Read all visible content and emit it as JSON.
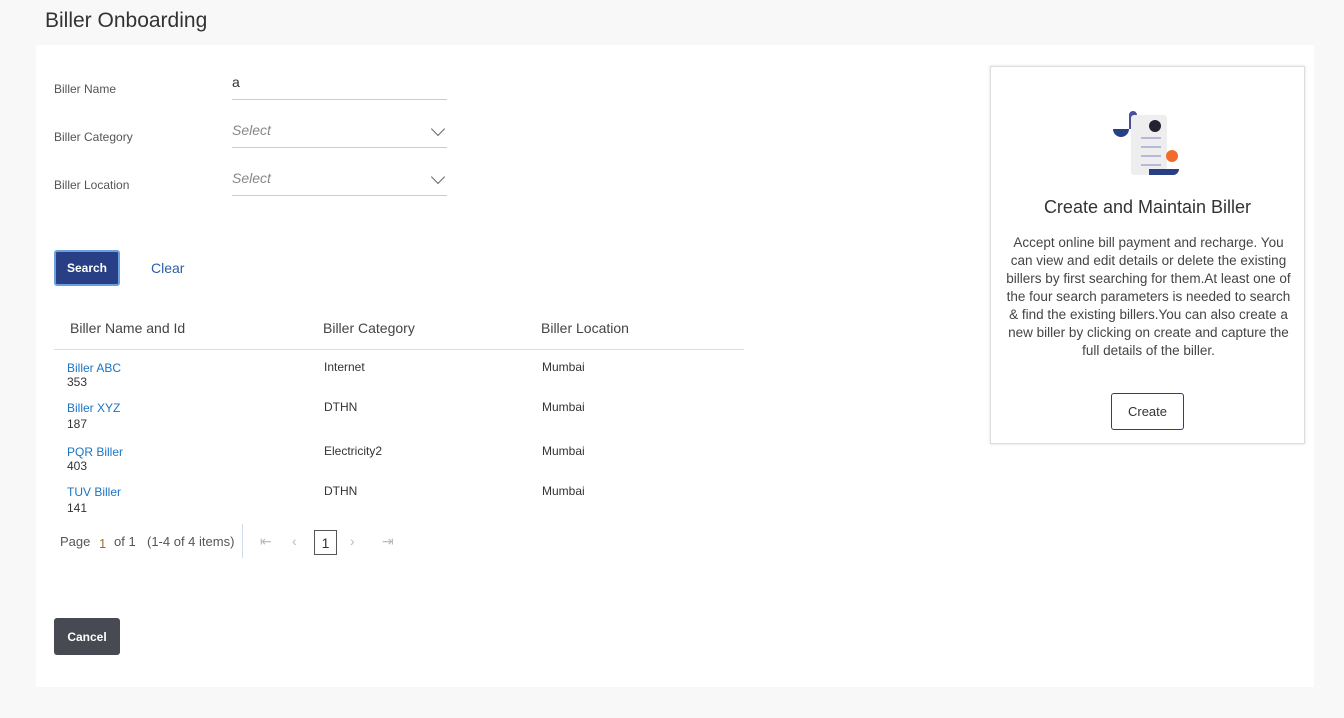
{
  "page_title": "Biller Onboarding",
  "form": {
    "biller_name_label": "Biller Name",
    "biller_name_value": "a",
    "category_label": "Biller Category",
    "category_value": "Select",
    "location_label": "Biller Location",
    "location_value": "Select"
  },
  "buttons": {
    "search": "Search",
    "clear": "Clear",
    "cancel": "Cancel",
    "create": "Create"
  },
  "table": {
    "headers": [
      "Biller Name and Id",
      "Biller Category",
      "Biller Location"
    ],
    "rows": [
      {
        "name": "Biller ABC",
        "id": "353",
        "category": "Internet",
        "location": "Mumbai"
      },
      {
        "name": "Biller XYZ",
        "id": "187",
        "category": "DTHN",
        "location": "Mumbai"
      },
      {
        "name": "PQR Biller",
        "id": "403",
        "category": "Electricity2",
        "location": "Mumbai"
      },
      {
        "name": "TUV Biller",
        "id": "141",
        "category": "DTHN",
        "location": "Mumbai"
      }
    ]
  },
  "pagination": {
    "page_label": "Page",
    "page": "1",
    "of": "of 1",
    "items": "(1-4 of 4 items)",
    "current": "1"
  },
  "card": {
    "title": "Create and Maintain Biller",
    "description": "Accept online bill payment and recharge. You can view and edit details or delete the existing billers by first searching for them.At least one of the four search parameters is needed to search & find the existing billers.You can also create a new biller by clicking on create and capture the full details of the biller."
  }
}
